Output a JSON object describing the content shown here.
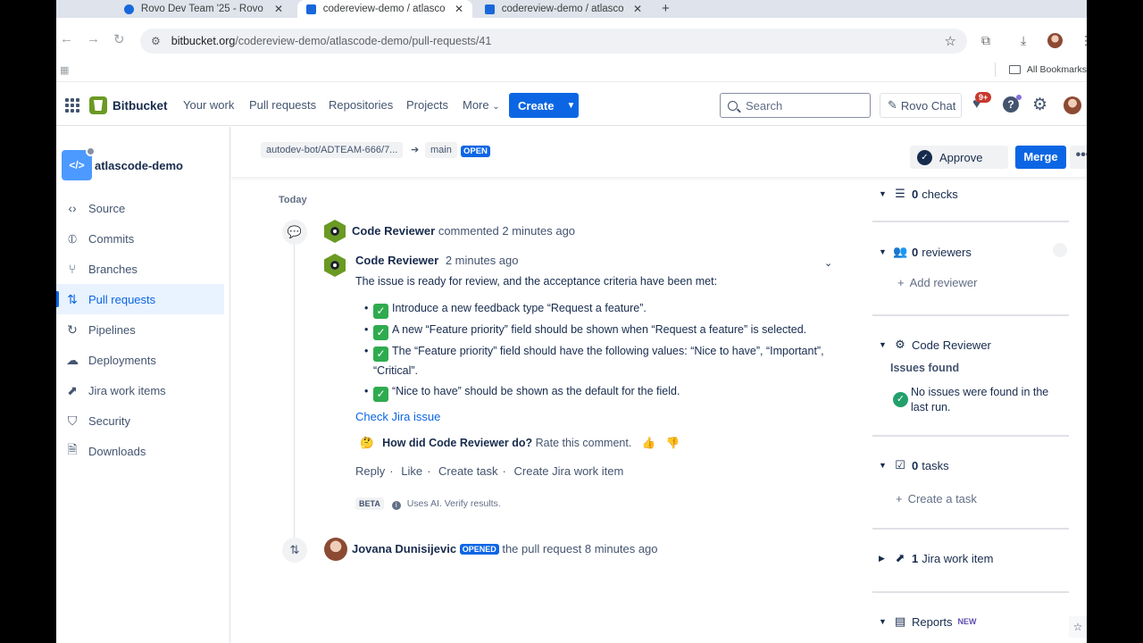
{
  "browser": {
    "tabs": [
      {
        "title": "Rovo Dev Team '25 - Rovo de",
        "close": "✕"
      },
      {
        "title": "codereview-demo / atlascode",
        "close": "✕"
      },
      {
        "title": "codereview-demo / atlascode",
        "close": "✕"
      }
    ],
    "new_tab": "+",
    "url_host": "bitbucket.org",
    "url_path": "/codereview-demo/atlascode-demo/pull-requests/41",
    "bookmarks_label": "All Bookmarks"
  },
  "topnav": {
    "product": "Bitbucket",
    "links": [
      "Your work",
      "Pull requests",
      "Repositories",
      "Projects",
      "More"
    ],
    "create_label": "Create",
    "search_placeholder": "Search",
    "rovo_chat": "Rovo Chat",
    "notifications_badge": "9+"
  },
  "sidebar": {
    "repo_name": "atlascode-demo",
    "items": [
      {
        "label": "Source",
        "icon": "code-icon"
      },
      {
        "label": "Commits",
        "icon": "commit-icon"
      },
      {
        "label": "Branches",
        "icon": "branch-icon"
      },
      {
        "label": "Pull requests",
        "icon": "pull-request-icon",
        "active": true
      },
      {
        "label": "Pipelines",
        "icon": "pipelines-icon"
      },
      {
        "label": "Deployments",
        "icon": "deployments-icon"
      },
      {
        "label": "Jira work items",
        "icon": "jira-icon"
      },
      {
        "label": "Security",
        "icon": "shield-icon"
      },
      {
        "label": "Downloads",
        "icon": "file-icon"
      }
    ]
  },
  "pr": {
    "source_branch": "autodev-bot/ADTEAM-666/7...",
    "dest_branch": "main",
    "status": "OPEN",
    "approve": "Approve",
    "merge": "Merge",
    "more": "•••"
  },
  "activity": {
    "day": "Today",
    "comment_event": {
      "author": "Code Reviewer",
      "verb": "commented",
      "time": "2 minutes ago"
    },
    "comment": {
      "author": "Code Reviewer",
      "time": "2 minutes ago",
      "intro": "The issue is ready for review, and the acceptance criteria have been met:",
      "criteria": [
        "Introduce a new feedback type “Request a feature”.",
        "A new “Feature priority” field should be shown when “Request a feature” is selected.",
        "The “Feature priority” field should have the following values: “Nice to have”, “Important”, “Critical”.",
        "“Nice to have” should be shown as the default for the field."
      ],
      "link": "Check Jira issue",
      "rate_question": "How did Code Reviewer do?",
      "rate_cta": "Rate this comment.",
      "actions": [
        "Reply",
        "Like",
        "Create task",
        "Create Jira work item"
      ],
      "beta_label": "BETA",
      "beta_note": "Uses AI. Verify results."
    },
    "opened_event": {
      "author": "Jovana Dunisijevic",
      "badge": "OPENED",
      "text": "the pull request",
      "time": "8 minutes ago"
    }
  },
  "right_panel": {
    "checks_count": "0",
    "checks_label": "checks",
    "reviewers_count": "0",
    "reviewers_label": "reviewers",
    "add_reviewer": "Add reviewer",
    "code_reviewer": "Code Reviewer",
    "issues_found": "Issues found",
    "no_issues": "No issues were found in the last run.",
    "tasks_count": "0",
    "tasks_label": "tasks",
    "create_task": "Create a task",
    "jira_count": "1",
    "jira_label": "Jira work item",
    "reports": "Reports",
    "reports_badge": "NEW"
  },
  "colors": {
    "primary": "#0c66e4",
    "bitbucket_green": "#6a9a23",
    "success": "#22a06b",
    "badge_red": "#c9372c"
  }
}
